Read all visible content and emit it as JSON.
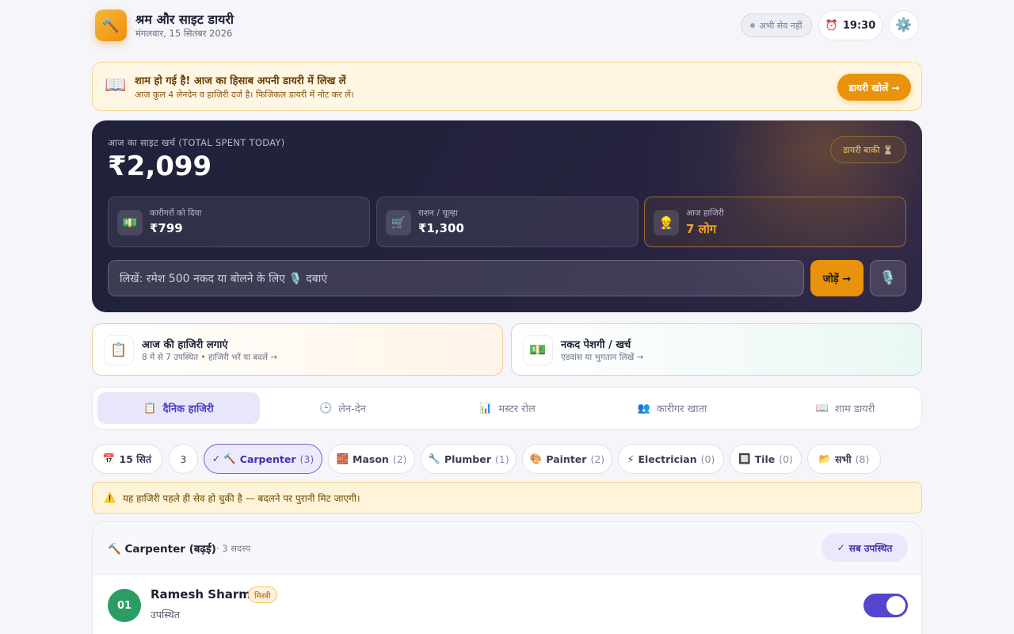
{
  "header": {
    "logo_icon": "hammer-icon",
    "title": "श्रम और साइट डायरी",
    "date": "मंगलवार, 15 सितंबर 2026",
    "save_status": "अभी सेव नहीं",
    "time": "19:30",
    "time_icon": "alarm-clock-icon",
    "settings_icon": "gear-icon"
  },
  "banner": {
    "icon": "book-icon",
    "title": "शाम हो गई है! आज का हिसाब अपनी डायरी में लिख लें",
    "subtitle": "आज कुल 4 लेनदेन व हाजिरी दर्ज है। फिजिकल डायरी में नोट कर लें।",
    "button": "डायरी खोलें →"
  },
  "summary": {
    "label": "आज का साइट खर्च (TOTAL SPENT TODAY)",
    "total": "₹2,099",
    "diary_status": "डायरी बाकी ⏳",
    "stats": [
      {
        "icon": "cash-icon",
        "label": "कारीगरों को दिया",
        "value": "₹799"
      },
      {
        "icon": "cart-icon",
        "label": "राशन / चूल्हा",
        "value": "₹1,300"
      },
      {
        "icon": "worker-icon",
        "label": "आज हाजिरी",
        "value": "7 लोग"
      }
    ],
    "entry_placeholder": "लिखें: रमेश 500 नकद या बोलने के लिए 🎙️ दबाएं",
    "add_button": "जोड़ें →",
    "mic_icon": "microphone-icon"
  },
  "actions": [
    {
      "icon": "clipboard-icon",
      "title": "आज की हाजिरी लगाएं",
      "subtitle": "8 में से 7 उपस्थित • हाजिरी भरें या बदलें →"
    },
    {
      "icon": "money-icon",
      "title": "नकद पेशगी / खर्च",
      "subtitle": "एडवांस या भुगतान लिखें →"
    }
  ],
  "tabs": [
    {
      "icon": "📋",
      "label": "दैनिक हाजिरी",
      "active": true
    },
    {
      "icon": "🕒",
      "label": "लेन-देन",
      "active": false
    },
    {
      "icon": "📊",
      "label": "मस्टर रोल",
      "active": false
    },
    {
      "icon": "👥",
      "label": "कारीगर खाता",
      "active": false
    },
    {
      "icon": "📖",
      "label": "शाम डायरी",
      "active": false
    }
  ],
  "filters": {
    "date": "15 सितं",
    "date_icon": "calendar-icon",
    "extra": "3",
    "trades": [
      {
        "icon": "✓ 🔨",
        "label": "Carpenter",
        "count": "(3)",
        "active": true
      },
      {
        "icon": "🧱",
        "label": "Mason",
        "count": "(2)",
        "active": false
      },
      {
        "icon": "🔧",
        "label": "Plumber",
        "count": "(1)",
        "active": false
      },
      {
        "icon": "🎨",
        "label": "Painter",
        "count": "(2)",
        "active": false
      },
      {
        "icon": "⚡",
        "label": "Electrician",
        "count": "(0)",
        "active": false
      },
      {
        "icon": "🔲",
        "label": "Tile",
        "count": "(0)",
        "active": false
      },
      {
        "icon": "📂",
        "label": "सभी",
        "count": "(8)",
        "active": false
      }
    ]
  },
  "warning": {
    "icon": "warning-icon",
    "text": "यह हाजिरी पहले ही सेव हो चुकी है — बदलने पर पुरानी मिट जाएगी।"
  },
  "group": {
    "title": "🔨 Carpenter (बढ़ई)",
    "count": "· 3 सदस्य",
    "mark_all": "सब उपस्थित",
    "workers": [
      {
        "number": "01",
        "name": "Ramesh Sharma",
        "role": "मिस्त्री",
        "status": "उपस्थित",
        "present": true
      }
    ]
  }
}
